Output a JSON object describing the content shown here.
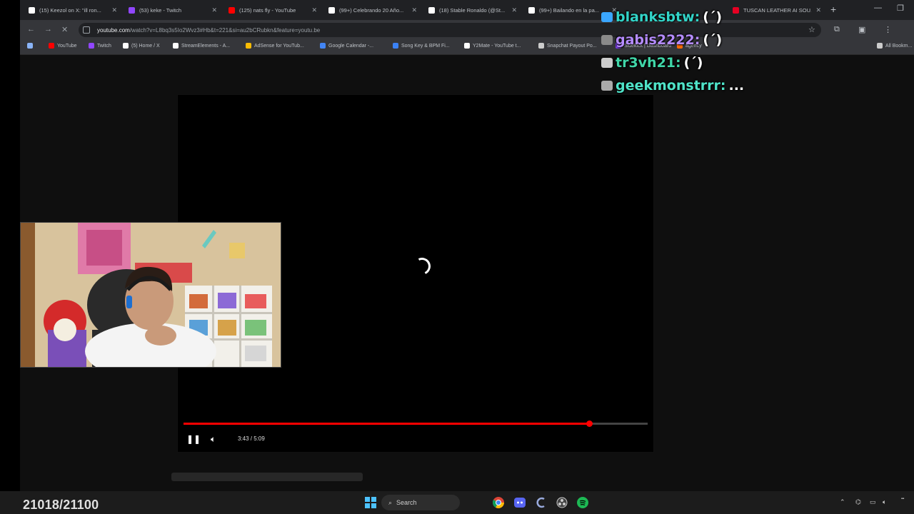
{
  "browser": {
    "tabs": [
      {
        "title": "(15) Keezol on X: \"ill ron...",
        "color": "#ffffff"
      },
      {
        "title": "(53) keke - Twitch",
        "color": "#9146ff"
      },
      {
        "title": "(125) nats fly - YouTube",
        "color": "#ff0000"
      },
      {
        "title": "(99+) Celebrando 20 Año...",
        "color": "#ffffff"
      },
      {
        "title": "(18) Stable Ronaldo (@St...",
        "color": "#ffffff"
      },
      {
        "title": "(99+) Bailando en la pa...",
        "color": "#ffffff"
      },
      {
        "title": "TUSCAN LEATHER AI SOU...",
        "color": "#e60023"
      }
    ],
    "url_host": "youtube.com",
    "url_path": "/watch?v=L8bq3s5Io2Wvz3#Hb&t=221&si=au2bCRubkn&feature=youtu.be",
    "bookmarks": [
      {
        "label": "YouTube",
        "color": "#ff0000"
      },
      {
        "label": "Twitch",
        "color": "#9146ff"
      },
      {
        "label": "(5) Home / X",
        "color": "#ffffff"
      },
      {
        "label": "StreamElements - A...",
        "color": "#ffffff"
      },
      {
        "label": "AdSense for YouTub...",
        "color": "#fbbc04"
      },
      {
        "label": "Google Calendar -...",
        "color": "#4285f4"
      },
      {
        "label": "Song Key & BPM Fi...",
        "color": "#3b82f6"
      },
      {
        "label": "Y2Mate - YouTube t...",
        "color": "#ffffff"
      },
      {
        "label": "Snapchat Payout Po...",
        "color": "#cccccc"
      },
      {
        "label": "Sidekick | Dashboard",
        "color": "#7c3aed"
      },
      {
        "label": "agency",
        "color": "#ff6a00"
      },
      {
        "label": "All Bookm...",
        "color": "#cccccc"
      }
    ]
  },
  "player": {
    "time": "3:43 / 5:09",
    "progress": 0.874
  },
  "chat": [
    {
      "user": "blanksbtw:",
      "message": "(´)",
      "color": "#32d4c8",
      "badge": "#3aa6ff"
    },
    {
      "user": "gabis2222:",
      "message": "(´)",
      "color": "#b58cff",
      "badge": "#8a8a8a"
    },
    {
      "user": "tr3vh21:",
      "message": "(´)",
      "color": "#40d6a8",
      "badge": "#cccccc"
    },
    {
      "user": "geekmonstrrr:",
      "message": "...",
      "color": "#4fe3c8",
      "badge": "#aaaaaa"
    }
  ],
  "overlay": {
    "counter": "21018/21100"
  },
  "taskbar": {
    "search_label": "Search"
  }
}
